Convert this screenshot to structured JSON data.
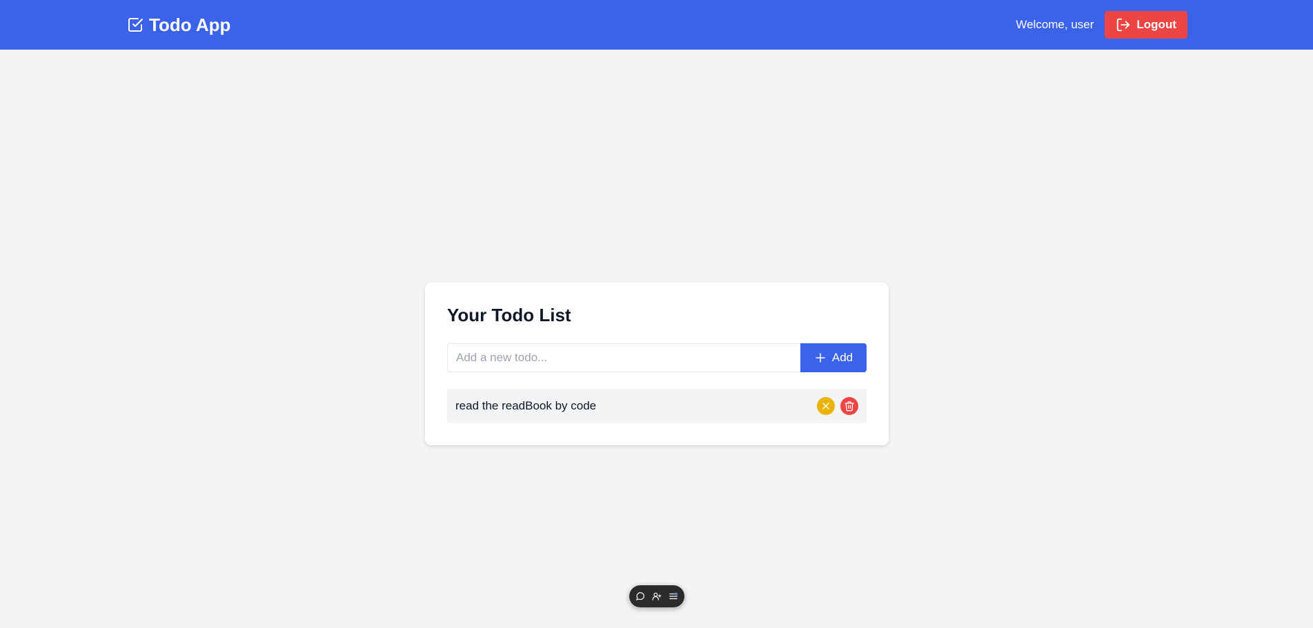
{
  "header": {
    "app_title": "Todo App",
    "welcome_text": "Welcome, user",
    "logout_label": "Logout"
  },
  "todo_card": {
    "title": "Your Todo List",
    "input_placeholder": "Add a new todo...",
    "input_value": "",
    "add_label": "Add",
    "items": [
      {
        "text": "read the readBook by code",
        "completed": false
      }
    ]
  },
  "floating_toolbar": {
    "icons": [
      "chat-icon",
      "user-add-icon",
      "list-settings-icon"
    ]
  },
  "colors": {
    "primary": "#3b63e9",
    "danger": "#ef4444",
    "warning": "#eab308",
    "background": "#f3f4f6"
  }
}
